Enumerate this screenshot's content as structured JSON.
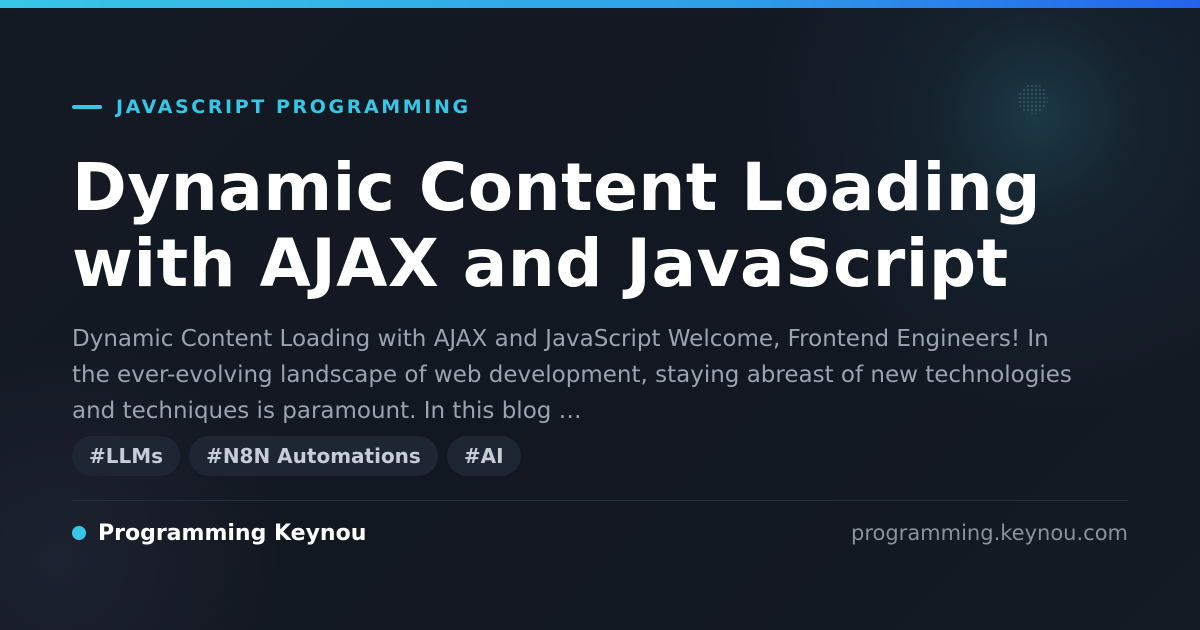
{
  "theme": {
    "accent": "#38c6e6",
    "background": "#121721",
    "title_color": "#ffffff",
    "text_color": "#9aa3af"
  },
  "header": {
    "category": "JAVASCRIPT PROGRAMMING"
  },
  "main": {
    "title": "Dynamic Content Loading with AJAX and JavaScript",
    "excerpt": "Dynamic Content Loading with AJAX and JavaScript Welcome, Frontend Engineers! In the ever-evolving landscape of web development, staying abreast of new technologies and techniques is paramount. In this blog …",
    "tags": [
      "#LLMs",
      "#N8N Automations",
      "#AI"
    ]
  },
  "footer": {
    "brand": "Programming Keynou",
    "url": "programming.keynou.com"
  }
}
